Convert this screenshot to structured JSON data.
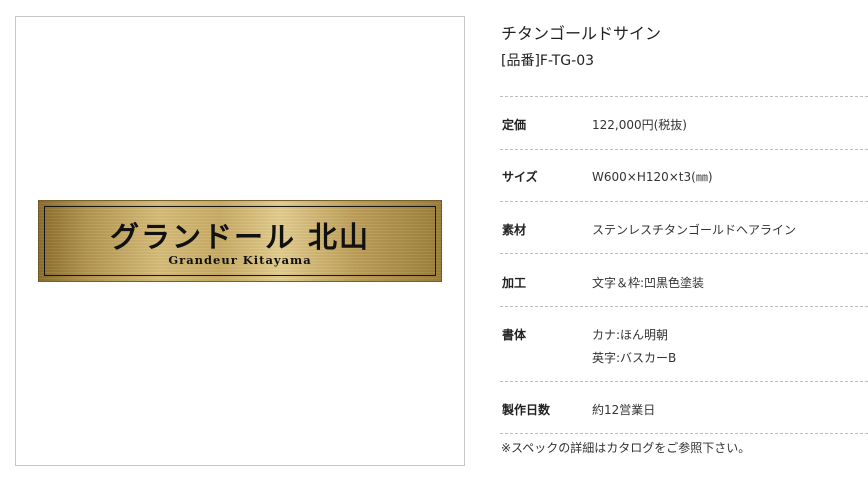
{
  "product": {
    "name": "チタンゴールドサイン",
    "code": "[品番]F-TG-03"
  },
  "sample_plate": {
    "title": "グランドール 北山",
    "subtitle": "Grandeur Kitayama"
  },
  "specs": [
    {
      "label": "定価",
      "values": [
        "122,000円(税抜)"
      ]
    },
    {
      "label": "サイズ",
      "values": [
        "W600×H120×t3(㎜)"
      ]
    },
    {
      "label": "素材",
      "values": [
        "ステンレスチタンゴールドヘアライン"
      ]
    },
    {
      "label": "加工",
      "values": [
        "文字＆枠:凹黒色塗装"
      ]
    },
    {
      "label": "書体",
      "values": [
        "カナ:ほん明朝",
        "英字:バスカーB"
      ]
    },
    {
      "label": "製作日数",
      "values": [
        "約12営業日"
      ]
    }
  ],
  "note": "※スペックの詳細はカタログをご参照下さい。"
}
